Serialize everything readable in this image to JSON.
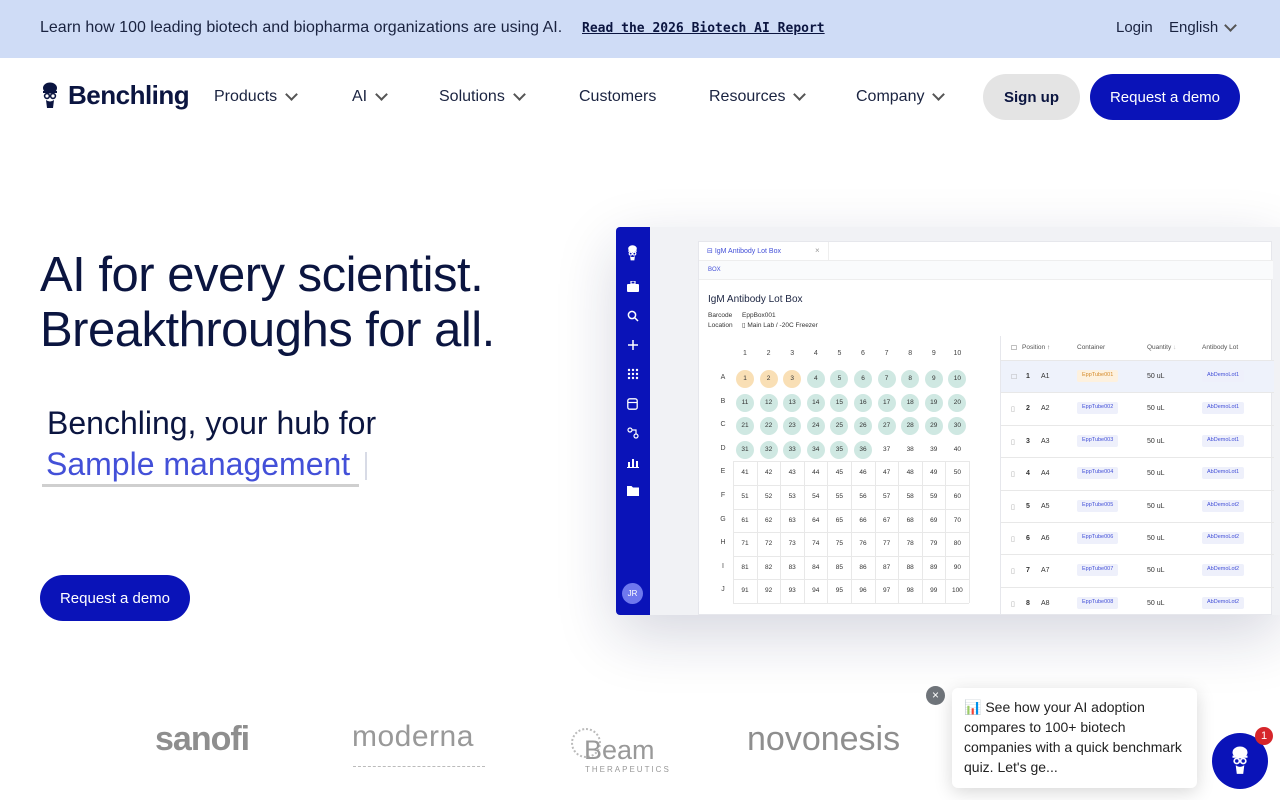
{
  "announce": {
    "text": "Learn how 100 leading biotech and biopharma organizations are using AI.",
    "link": "Read the 2026 Biotech AI Report",
    "login": "Login",
    "language": "English"
  },
  "header": {
    "logo": "Benchling",
    "nav": [
      "Products",
      "AI",
      "Solutions",
      "Customers",
      "Resources",
      "Company"
    ],
    "signup": "Sign up",
    "demo": "Request a demo"
  },
  "hero": {
    "title_line1": "AI for every scientist.",
    "title_line2": "Breakthroughs for all.",
    "hub": "Benchling, your hub for",
    "hub_word": "Sample management",
    "cta": "Request a demo"
  },
  "mock": {
    "tab": "IgM Antibody Lot Box",
    "subtab": "BOX",
    "box_title": "IgM Antibody Lot Box",
    "barcode_label": "Barcode",
    "barcode_value": "EppBox001",
    "location_label": "Location",
    "location_value": "Main Lab / -20C Freezer",
    "avatar": "JR",
    "columns": [
      "1",
      "2",
      "3",
      "4",
      "5",
      "6",
      "7",
      "8",
      "9",
      "10"
    ],
    "rows": [
      "A",
      "B",
      "C",
      "D",
      "E",
      "F",
      "G",
      "H",
      "I",
      "J"
    ],
    "table_headers": [
      "Position",
      "Container",
      "Quantity",
      "Antibody Lot"
    ],
    "table_rows": [
      {
        "n": "1",
        "pos": "A1",
        "container": "EppTube001",
        "qty": "50 uL",
        "lot": "AbDemoLot1"
      },
      {
        "n": "2",
        "pos": "A2",
        "container": "EppTube002",
        "qty": "50 uL",
        "lot": "AbDemoLot1"
      },
      {
        "n": "3",
        "pos": "A3",
        "container": "EppTube003",
        "qty": "50 uL",
        "lot": "AbDemoLot1"
      },
      {
        "n": "4",
        "pos": "A4",
        "container": "EppTube004",
        "qty": "50 uL",
        "lot": "AbDemoLot1"
      },
      {
        "n": "5",
        "pos": "A5",
        "container": "EppTube005",
        "qty": "50 uL",
        "lot": "AbDemoLot2"
      },
      {
        "n": "6",
        "pos": "A6",
        "container": "EppTube006",
        "qty": "50 uL",
        "lot": "AbDemoLot2"
      },
      {
        "n": "7",
        "pos": "A7",
        "container": "EppTube007",
        "qty": "50 uL",
        "lot": "AbDemoLot2"
      },
      {
        "n": "8",
        "pos": "A8",
        "container": "EppTube008",
        "qty": "50 uL",
        "lot": "AbDemoLot2"
      }
    ]
  },
  "logos": {
    "sanofi": "sanofi",
    "moderna": "moderna",
    "beam": "Beam",
    "beam_sub": "THERAPEUTICS",
    "novonesis": "novonesis"
  },
  "chat": {
    "message": "📊 See how your AI adoption compares to 100+ biotech companies with a quick benchmark quiz. Let's ge...",
    "badge": "1",
    "close": "×"
  },
  "colors": {
    "brand": "#0a13b8",
    "accent": "#4350d8",
    "announce_bg": "#cfdcf6"
  }
}
